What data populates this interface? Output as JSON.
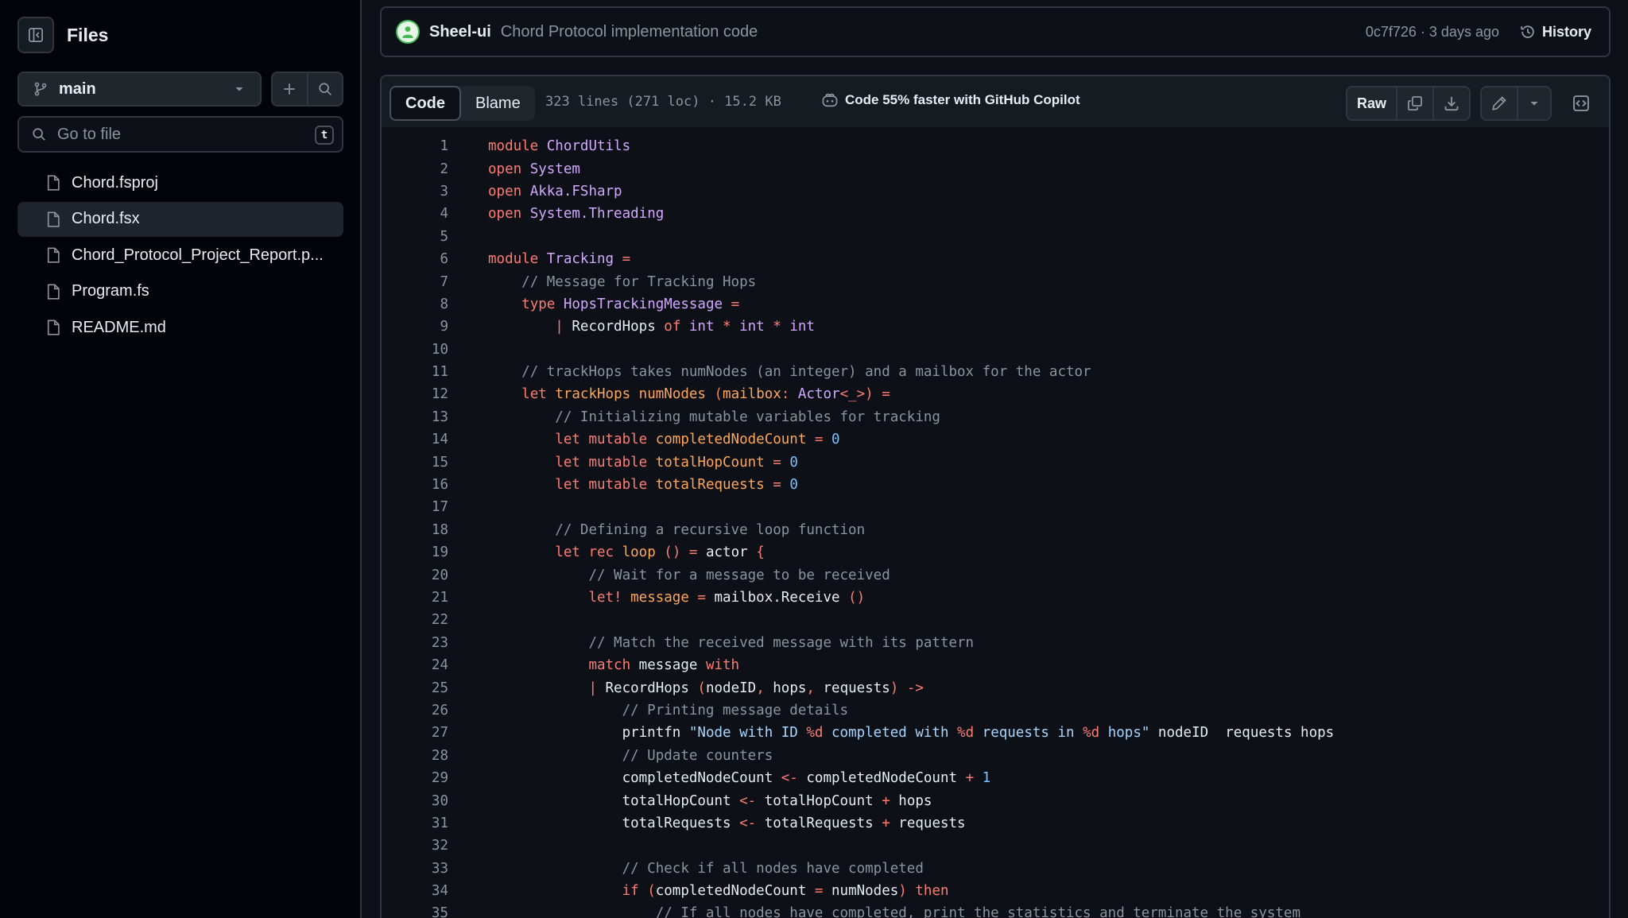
{
  "sidebar": {
    "title": "Files",
    "branch": "main",
    "search_placeholder": "Go to file",
    "search_shortcut": "t",
    "files": [
      {
        "name": "Chord.fsproj",
        "active": false
      },
      {
        "name": "Chord.fsx",
        "active": true
      },
      {
        "name": "Chord_Protocol_Project_Report.p...",
        "active": false
      },
      {
        "name": "Program.fs",
        "active": false
      },
      {
        "name": "README.md",
        "active": false
      }
    ]
  },
  "commit": {
    "author": "Sheel-ui",
    "message": "Chord Protocol implementation code",
    "sha_time": "0c7f726 · 3 days ago",
    "history_label": "History"
  },
  "file_header": {
    "tab_code": "Code",
    "tab_blame": "Blame",
    "meta": "323 lines (271 loc) · 15.2 KB",
    "copilot": "Code 55% faster with GitHub Copilot",
    "raw_label": "Raw"
  },
  "code": {
    "lines": [
      [
        [
          "kw",
          "module "
        ],
        [
          "mod",
          "ChordUtils"
        ]
      ],
      [
        [
          "kw",
          "open "
        ],
        [
          "mod",
          "System"
        ]
      ],
      [
        [
          "kw",
          "open "
        ],
        [
          "mod",
          "Akka.FSharp"
        ]
      ],
      [
        [
          "kw",
          "open "
        ],
        [
          "mod",
          "System.Threading"
        ]
      ],
      [],
      [
        [
          "kw",
          "module "
        ],
        [
          "mod",
          "Tracking"
        ],
        [
          "kw",
          " ="
        ]
      ],
      [
        [
          "",
          "    "
        ],
        [
          "cm",
          "// Message for Tracking Hops"
        ]
      ],
      [
        [
          "",
          "    "
        ],
        [
          "kw",
          "type "
        ],
        [
          "mod",
          "HopsTrackingMessage"
        ],
        [
          "kw",
          " ="
        ]
      ],
      [
        [
          "",
          "        "
        ],
        [
          "kw",
          "| "
        ],
        [
          "",
          "RecordHops "
        ],
        [
          "kw",
          "of "
        ],
        [
          "mod",
          "int"
        ],
        [
          "kw",
          " * "
        ],
        [
          "mod",
          "int"
        ],
        [
          "kw",
          " * "
        ],
        [
          "mod",
          "int"
        ]
      ],
      [],
      [
        [
          "",
          "    "
        ],
        [
          "cm",
          "// trackHops takes numNodes (an integer) and a mailbox for the actor"
        ]
      ],
      [
        [
          "",
          "    "
        ],
        [
          "kw",
          "let "
        ],
        [
          "var",
          "trackHops numNodes "
        ],
        [
          "kw",
          "("
        ],
        [
          "var",
          "mailbox"
        ],
        [
          "kw",
          ": "
        ],
        [
          "mod",
          "Actor"
        ],
        [
          "kw",
          "<_>) ="
        ]
      ],
      [
        [
          "",
          "        "
        ],
        [
          "cm",
          "// Initializing mutable variables for tracking"
        ]
      ],
      [
        [
          "",
          "        "
        ],
        [
          "kw",
          "let mutable "
        ],
        [
          "var",
          "completedNodeCount"
        ],
        [
          "kw",
          " = "
        ],
        [
          "num",
          "0"
        ]
      ],
      [
        [
          "",
          "        "
        ],
        [
          "kw",
          "let mutable "
        ],
        [
          "var",
          "totalHopCount"
        ],
        [
          "kw",
          " = "
        ],
        [
          "num",
          "0"
        ]
      ],
      [
        [
          "",
          "        "
        ],
        [
          "kw",
          "let mutable "
        ],
        [
          "var",
          "totalRequests"
        ],
        [
          "kw",
          " = "
        ],
        [
          "num",
          "0"
        ]
      ],
      [],
      [
        [
          "",
          "        "
        ],
        [
          "cm",
          "// Defining a recursive loop function"
        ]
      ],
      [
        [
          "",
          "        "
        ],
        [
          "kw",
          "let rec "
        ],
        [
          "var",
          "loop "
        ],
        [
          "kw",
          "() = "
        ],
        [
          "",
          "actor "
        ],
        [
          "kw",
          "{"
        ]
      ],
      [
        [
          "",
          "            "
        ],
        [
          "cm",
          "// Wait for a message to be received"
        ]
      ],
      [
        [
          "",
          "            "
        ],
        [
          "kw",
          "let! "
        ],
        [
          "var",
          "message"
        ],
        [
          "kw",
          " = "
        ],
        [
          "",
          "mailbox.Receive "
        ],
        [
          "kw",
          "()"
        ]
      ],
      [],
      [
        [
          "",
          "            "
        ],
        [
          "cm",
          "// Match the received message with its pattern"
        ]
      ],
      [
        [
          "",
          "            "
        ],
        [
          "kw",
          "match "
        ],
        [
          "",
          "message "
        ],
        [
          "kw",
          "with"
        ]
      ],
      [
        [
          "",
          "            "
        ],
        [
          "kw",
          "| "
        ],
        [
          "",
          "RecordHops "
        ],
        [
          "kw",
          "("
        ],
        [
          "",
          "nodeID"
        ],
        [
          "kw",
          ", "
        ],
        [
          "",
          "hops"
        ],
        [
          "kw",
          ", "
        ],
        [
          "",
          "requests"
        ],
        [
          "kw",
          ") ->"
        ]
      ],
      [
        [
          "",
          "                "
        ],
        [
          "cm",
          "// Printing message details"
        ]
      ],
      [
        [
          "",
          "                "
        ],
        [
          "",
          "printfn "
        ],
        [
          "str",
          "\"Node with ID "
        ],
        [
          "kw",
          "%d"
        ],
        [
          "str",
          " completed with "
        ],
        [
          "kw",
          "%d"
        ],
        [
          "str",
          " requests in "
        ],
        [
          "kw",
          "%d"
        ],
        [
          "str",
          " hops\""
        ],
        [
          "",
          " nodeID  requests hops"
        ]
      ],
      [
        [
          "",
          "                "
        ],
        [
          "cm",
          "// Update counters"
        ]
      ],
      [
        [
          "",
          "                "
        ],
        [
          "",
          "completedNodeCount "
        ],
        [
          "kw",
          "<- "
        ],
        [
          "",
          "completedNodeCount "
        ],
        [
          "kw",
          "+ "
        ],
        [
          "num",
          "1"
        ]
      ],
      [
        [
          "",
          "                "
        ],
        [
          "",
          "totalHopCount "
        ],
        [
          "kw",
          "<- "
        ],
        [
          "",
          "totalHopCount "
        ],
        [
          "kw",
          "+ "
        ],
        [
          "",
          "hops"
        ]
      ],
      [
        [
          "",
          "                "
        ],
        [
          "",
          "totalRequests "
        ],
        [
          "kw",
          "<- "
        ],
        [
          "",
          "totalRequests "
        ],
        [
          "kw",
          "+ "
        ],
        [
          "",
          "requests"
        ]
      ],
      [],
      [
        [
          "",
          "                "
        ],
        [
          "cm",
          "// Check if all nodes have completed"
        ]
      ],
      [
        [
          "",
          "                "
        ],
        [
          "kw",
          "if "
        ],
        [
          "kw",
          "("
        ],
        [
          "",
          "completedNodeCount "
        ],
        [
          "kw",
          "= "
        ],
        [
          "",
          "numNodes"
        ],
        [
          "kw",
          ") then"
        ]
      ],
      [
        [
          "",
          "                    "
        ],
        [
          "cm",
          "// If all nodes have completed, print the statistics and terminate the system"
        ]
      ]
    ]
  }
}
